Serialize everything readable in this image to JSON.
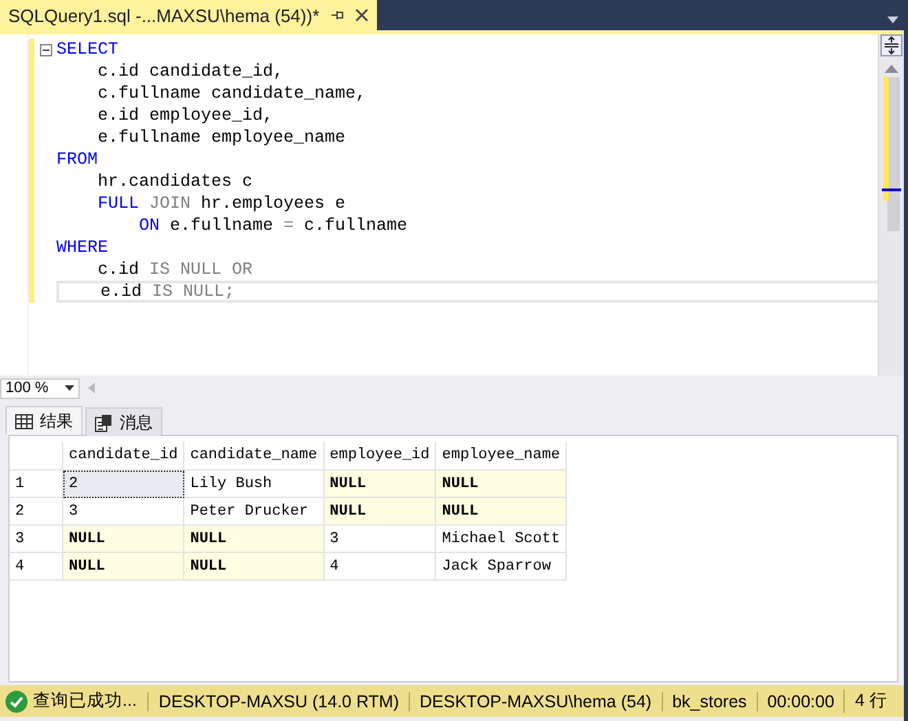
{
  "document_tab": {
    "title": "SQLQuery1.sql -...MAXSU\\hema (54))*",
    "selected": true
  },
  "editor": {
    "lines": [
      [
        {
          "text": "SELECT",
          "kind": "keyword"
        }
      ],
      [
        {
          "text": "    c.id candidate_id,",
          "kind": "plain"
        }
      ],
      [
        {
          "text": "    c.fullname candidate_name,",
          "kind": "plain"
        }
      ],
      [
        {
          "text": "    e.id employee_id,",
          "kind": "plain"
        }
      ],
      [
        {
          "text": "    e.fullname employee_name",
          "kind": "plain"
        }
      ],
      [
        {
          "text": "FROM",
          "kind": "keyword"
        }
      ],
      [
        {
          "text": "    hr.candidates c",
          "kind": "plain"
        }
      ],
      [
        {
          "text": "    FULL",
          "kind": "keyword"
        },
        {
          "text": " JOIN",
          "kind": "operator"
        },
        {
          "text": " hr.employees e",
          "kind": "plain"
        }
      ],
      [
        {
          "text": "        ON",
          "kind": "keyword"
        },
        {
          "text": " e.fullname ",
          "kind": "plain"
        },
        {
          "text": "=",
          "kind": "operator"
        },
        {
          "text": " c.fullname",
          "kind": "plain"
        }
      ],
      [
        {
          "text": "WHERE",
          "kind": "keyword"
        }
      ],
      [
        {
          "text": "    c.id ",
          "kind": "plain"
        },
        {
          "text": "IS NULL OR",
          "kind": "operator"
        }
      ],
      [
        {
          "text": "    e.id ",
          "kind": "plain"
        },
        {
          "text": "IS NULL;",
          "kind": "operator"
        }
      ]
    ],
    "zoom": "100 %"
  },
  "result_tabs": [
    {
      "label": "结果",
      "selected": true
    },
    {
      "label": "消息",
      "selected": false
    }
  ],
  "table": {
    "columns": [
      "candidate_id",
      "candidate_name",
      "employee_id",
      "employee_name"
    ],
    "rows": [
      {
        "number": "1",
        "cells": [
          {
            "text": "2",
            "kind": "value",
            "selected": true
          },
          {
            "text": "Lily Bush",
            "kind": "value",
            "selected": false
          },
          {
            "text": "NULL",
            "kind": "null",
            "selected": false
          },
          {
            "text": "NULL",
            "kind": "null",
            "selected": false
          }
        ]
      },
      {
        "number": "2",
        "cells": [
          {
            "text": "3",
            "kind": "value",
            "selected": false
          },
          {
            "text": "Peter Drucker",
            "kind": "value",
            "selected": false
          },
          {
            "text": "NULL",
            "kind": "null",
            "selected": false
          },
          {
            "text": "NULL",
            "kind": "null",
            "selected": false
          }
        ]
      },
      {
        "number": "3",
        "cells": [
          {
            "text": "NULL",
            "kind": "null",
            "selected": false
          },
          {
            "text": "NULL",
            "kind": "null",
            "selected": false
          },
          {
            "text": "3",
            "kind": "value",
            "selected": false
          },
          {
            "text": "Michael Scott",
            "kind": "value",
            "selected": false
          }
        ]
      },
      {
        "number": "4",
        "cells": [
          {
            "text": "NULL",
            "kind": "null",
            "selected": false
          },
          {
            "text": "NULL",
            "kind": "null",
            "selected": false
          },
          {
            "text": "4",
            "kind": "value",
            "selected": false
          },
          {
            "text": "Jack Sparrow",
            "kind": "value",
            "selected": false
          }
        ]
      }
    ]
  },
  "status_bar": {
    "message": "查询已成功...",
    "server": "DESKTOP-MAXSU (14.0 RTM)",
    "user": "DESKTOP-MAXSU\\hema (54)",
    "database": "bk_stores",
    "time": "00:00:00",
    "rows": "4 行"
  }
}
